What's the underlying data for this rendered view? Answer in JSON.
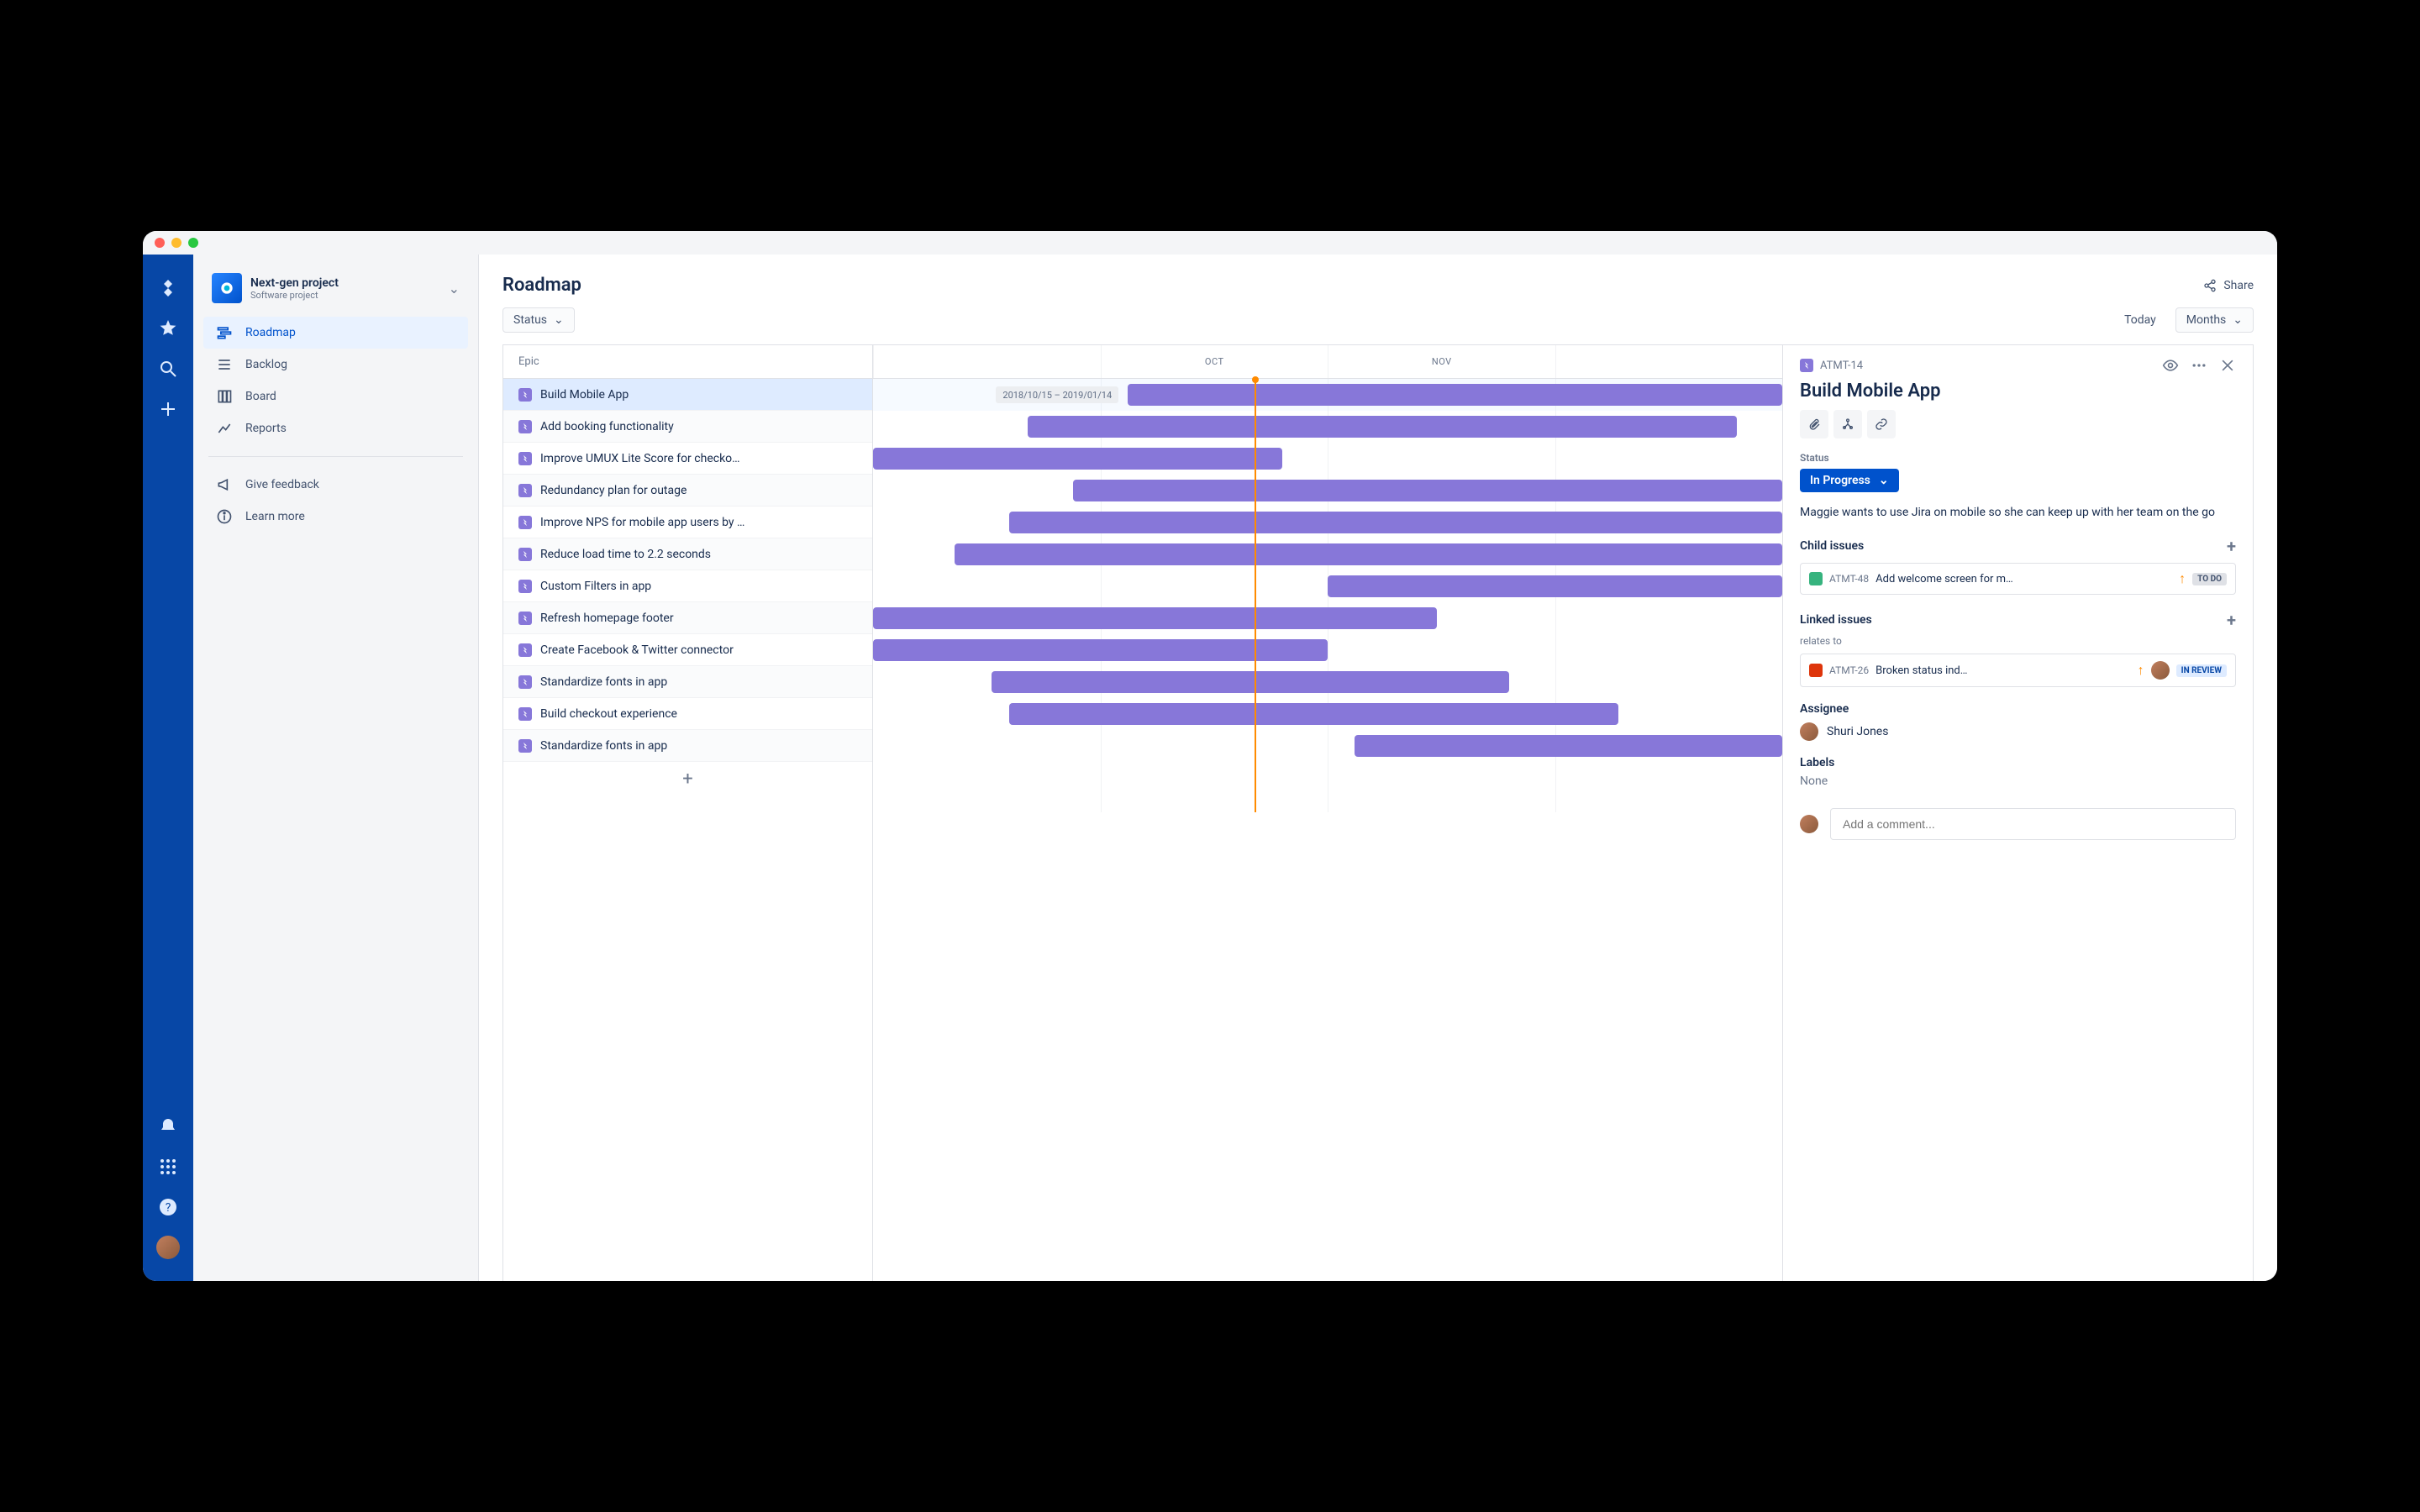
{
  "project": {
    "name": "Next-gen project",
    "type": "Software project"
  },
  "sidebar": {
    "items": [
      {
        "label": "Roadmap"
      },
      {
        "label": "Backlog"
      },
      {
        "label": "Board"
      },
      {
        "label": "Reports"
      }
    ],
    "feedback": "Give feedback",
    "learn": "Learn more"
  },
  "page": {
    "title": "Roadmap",
    "share": "Share",
    "status_filter": "Status",
    "today": "Today",
    "range": "Months"
  },
  "timeline": {
    "header": [
      "",
      "OCT",
      "NOV",
      ""
    ],
    "today_pct": 42,
    "epic_header": "Epic",
    "date_badge": "2018/10/15 – 2019/01/14"
  },
  "epics": [
    {
      "title": "Build Mobile App",
      "start": 28,
      "end": 100,
      "selected": true,
      "badge": true
    },
    {
      "title": "Add booking functionality",
      "start": 17,
      "end": 95
    },
    {
      "title": "Improve UMUX Lite Score for checko…",
      "start": 0,
      "end": 45
    },
    {
      "title": "Redundancy plan for outage",
      "start": 22,
      "end": 100
    },
    {
      "title": "Improve NPS for mobile app users by …",
      "start": 15,
      "end": 100
    },
    {
      "title": "Reduce load time to 2.2 seconds",
      "start": 9,
      "end": 100
    },
    {
      "title": "Custom Filters in app",
      "start": 50,
      "end": 100
    },
    {
      "title": "Refresh homepage footer",
      "start": 0,
      "end": 62
    },
    {
      "title": "Create Facebook & Twitter connector",
      "start": 0,
      "end": 50
    },
    {
      "title": "Standardize fonts in app",
      "start": 13,
      "end": 70
    },
    {
      "title": "Build checkout experience",
      "start": 15,
      "end": 82
    },
    {
      "title": "Standardize fonts in app",
      "start": 53,
      "end": 100
    }
  ],
  "detail": {
    "key": "ATMT-14",
    "title": "Build Mobile App",
    "status_label": "Status",
    "status": "In Progress",
    "description": "Maggie wants to use Jira on mobile so she can keep up with her team on the go",
    "child_issues_label": "Child issues",
    "child_issues": [
      {
        "type": "story",
        "key": "ATMT-48",
        "summary": "Add welcome screen for m…",
        "status": "TO DO"
      }
    ],
    "linked_issues_label": "Linked issues",
    "linked_relation": "relates to",
    "linked_issues": [
      {
        "type": "bug",
        "key": "ATMT-26",
        "summary": "Broken status ind…",
        "status": "IN REVIEW"
      }
    ],
    "assignee_label": "Assignee",
    "assignee": "Shuri Jones",
    "labels_label": "Labels",
    "labels_none": "None",
    "comment_placeholder": "Add a comment..."
  }
}
